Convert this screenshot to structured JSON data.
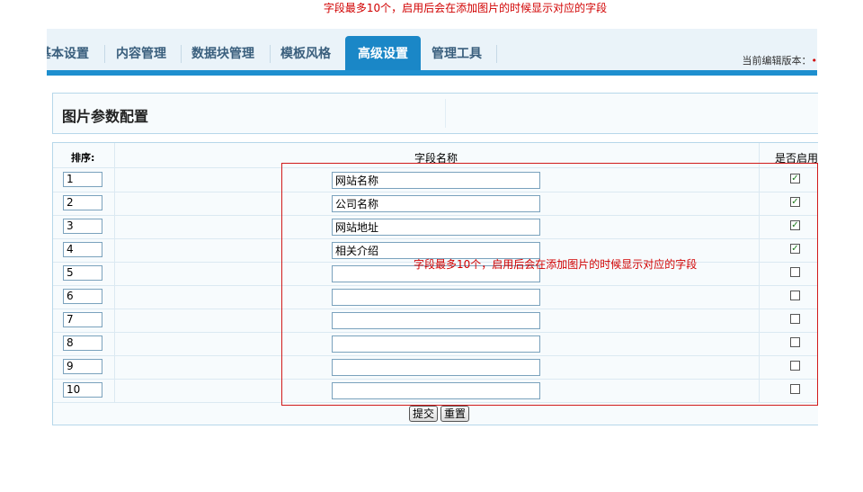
{
  "top_note": "字段最多10个，启用后会在添加图片的时候显示对应的字段",
  "nav": {
    "tabs": [
      {
        "label": "基本设置"
      },
      {
        "label": "内容管理"
      },
      {
        "label": "数据块管理"
      },
      {
        "label": "模板风格"
      },
      {
        "label": "高级设置"
      },
      {
        "label": "管理工具"
      }
    ],
    "active_tab": "高级设置",
    "version_label": "当前编辑版本："
  },
  "panel": {
    "title": "图片参数配置"
  },
  "table": {
    "headers": {
      "order": "排序:",
      "name": "字段名称",
      "enabled": "是否启用"
    },
    "rows": [
      {
        "order": "1",
        "name": "网站名称",
        "enabled": true
      },
      {
        "order": "2",
        "name": "公司名称",
        "enabled": true
      },
      {
        "order": "3",
        "name": "网站地址",
        "enabled": true
      },
      {
        "order": "4",
        "name": "相关介绍",
        "enabled": true
      },
      {
        "order": "5",
        "name": "",
        "enabled": false
      },
      {
        "order": "6",
        "name": "",
        "enabled": false
      },
      {
        "order": "7",
        "name": "",
        "enabled": false
      },
      {
        "order": "8",
        "name": "",
        "enabled": false
      },
      {
        "order": "9",
        "name": "",
        "enabled": false
      },
      {
        "order": "10",
        "name": "",
        "enabled": false
      }
    ]
  },
  "buttons": {
    "submit": "提交",
    "reset": "重置"
  },
  "annotation": "字段最多10个，启用后会在添加图片的时候显示对应的字段",
  "colors": {
    "accent": "#1a87c7",
    "note": "#d10000",
    "check": "#1a7a1a"
  }
}
